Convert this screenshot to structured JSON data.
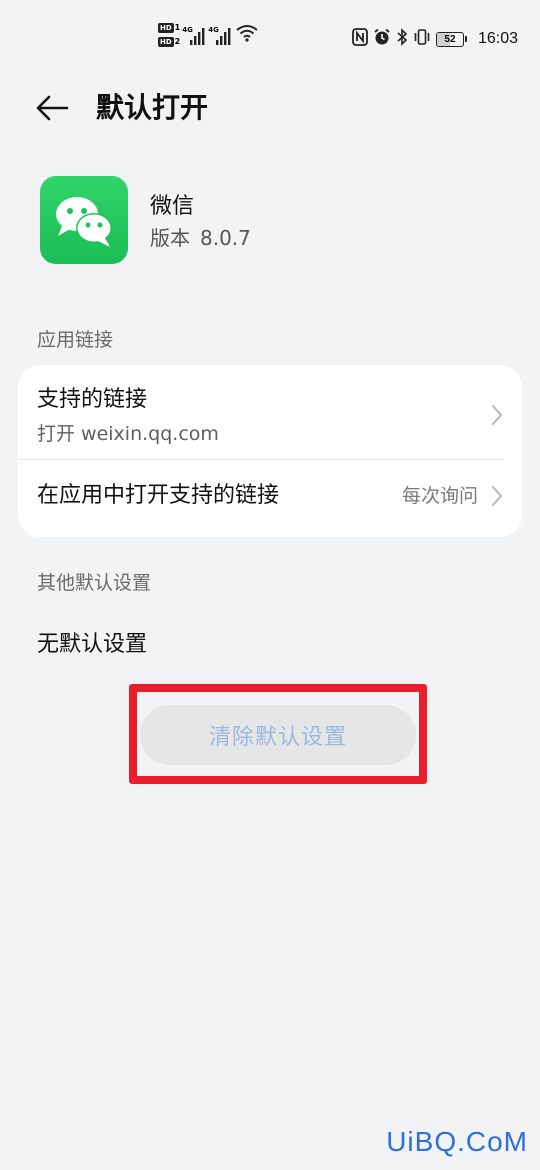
{
  "status_bar": {
    "hd1": "HD",
    "hd1_num": "1",
    "hd2": "HD",
    "hd2_num": "2",
    "sig1_tag": "4G",
    "sig2_tag": "4G",
    "battery_level": "52",
    "battery_fraction": 0.52,
    "time": "16:03",
    "icons": [
      "nfc-icon",
      "alarm-icon",
      "bluetooth-icon",
      "vibrate-icon"
    ]
  },
  "header": {
    "title": "默认打开"
  },
  "app": {
    "name": "微信",
    "version_label": "版本",
    "version": "8.0.7",
    "icon_color": "#1fc25a"
  },
  "sections": {
    "app_links": "应用链接",
    "other_defaults": "其他默认设置"
  },
  "links_card": {
    "supported_links_title": "支持的链接",
    "supported_links_sub": "打开 weixin.qq.com",
    "open_in_app_title": "在应用中打开支持的链接",
    "open_in_app_value": "每次询问"
  },
  "other": {
    "no_default": "无默认设置",
    "clear_button": "清除默认设置"
  },
  "watermark": "UiBQ.CoM",
  "colors": {
    "highlight": "#ea1f2b",
    "button_text_disabled": "#9bb8dd",
    "background": "#f1f3f5"
  }
}
